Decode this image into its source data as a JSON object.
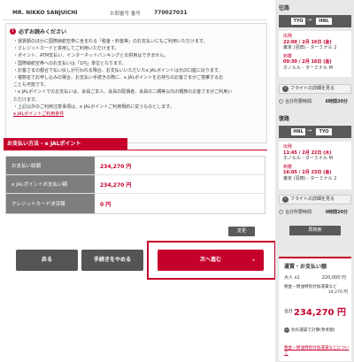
{
  "customer": {
    "name": "MR. NIKKO SANJUICHI",
    "booking_label": "お問番号 番号",
    "booking_number": "770027031"
  },
  "notice": {
    "title": "必ずお読みください",
    "items": [
      "・運賃額のほかに国際線航空券に含まれる「税金・料金等」のお支払いにもご利用いただけます。",
      "・クレジットカードと併用してご利用いただけます。",
      "・ポイント、ATM支払い、インターネットバンキングとの併用はできません。",
      "・国際線航空券へのお支払いは「1円」単位となります。",
      "・お客さまの都合で払い戻しが行われる場合、お支払いいただいたe JALポイントは元の口座に戻ります。",
      "・複数名でお申し込みの場合、お支払い手続きの際に、e JALポイントをお持ちのお客さまがご搭乗するお",
      "ことも可能です。",
      "・e JALポイントでのお支払いは、会員ご本人、会員の配偶者、会員の二親等以内の親族のお客さまがご利用い",
      "ただけます。",
      "・上記以外のご利用注意事項は、e JALポイントご利用規約に従うものとします。"
    ],
    "link": "e JALポイントご利用条件"
  },
  "payment": {
    "section_title": "お支払い方法 - e JALポイント",
    "rows": [
      {
        "label": "お支払い総額",
        "value": "234,270 円"
      },
      {
        "label": "e JALポイントお支払い額",
        "value": "234,270 円"
      },
      {
        "label": "クレジットカード決済額",
        "value": "0 円"
      }
    ],
    "change_label": "変更"
  },
  "buttons": {
    "back": "戻る",
    "cancel": "手続きをやめる",
    "next": "次へ進む"
  },
  "outbound": {
    "heading": "往路",
    "from": "TYO",
    "to": "HNL",
    "dep_label": "出発",
    "dep_time": "22:00 / 2月 16日 (金)",
    "dep_place": "東京 (羽田) - ターミナル 2",
    "arr_label": "到着",
    "arr_time": "09:30 / 2月 16日 (金)",
    "arr_place": "ホノルル - ターミナル M",
    "detail": "フライトの詳細を見る",
    "duration_label": "合計所要時間",
    "duration": "6時間30分"
  },
  "inbound": {
    "heading": "復路",
    "from": "HNL",
    "to": "TYO",
    "dep_label": "出発",
    "dep_time": "11:45 / 2月 22日 (木)",
    "dep_place": "ホノルル - ターミナル M",
    "arr_label": "到着",
    "arr_time": "16:05 / 2月 23日 (金)",
    "arr_place": "東京 (羽田) - ターミナル 2",
    "detail": "フライトの詳細を見る",
    "duration_label": "合計所要時間",
    "duration": "9時間20分"
  },
  "search_again": "再検索",
  "fare": {
    "heading": "運賃・お支払い額",
    "adult_label": "大人 x1",
    "adult_value": "220,000 円",
    "tax_label": "税金・燃油特別付加運賃など",
    "tax_value": "14,270 円",
    "total_label": "合計",
    "total": "234,270 円",
    "details_link": "別の運賃で計算(参考額)",
    "tax_link": "税金・燃油特別付加運賃などについて"
  },
  "colors": {
    "accent": "#c5002b",
    "dark_button": "#555555",
    "sidebar_bg": "#e8e8e8"
  }
}
